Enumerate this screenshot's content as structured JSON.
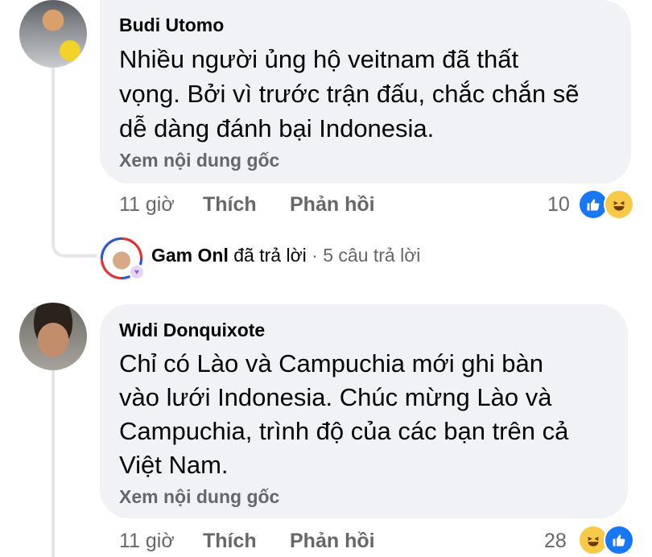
{
  "comments": [
    {
      "author": "Budi Utomo",
      "text_lines": [
        "Nhiều người ủng hộ veitnam đã thất",
        "vọng. Bởi vì trước trận đấu, chắc chắn sẽ",
        "dễ dàng đánh bại Indonesia."
      ],
      "see_original": "Xem nội dung gốc",
      "time": "11 giờ",
      "like_label": "Thích",
      "reply_label": "Phản hồi",
      "reaction_count": "10",
      "reactions": [
        "like-icon",
        "haha-icon"
      ]
    },
    {
      "author": "Widi Donquixote",
      "text_lines": [
        "Chỉ có Lào và Campuchia mới ghi bàn",
        "vào lưới Indonesia. Chúc mừng Lào và",
        "Campuchia, trình độ của các bạn trên cả",
        "Việt Nam."
      ],
      "see_original": "Xem nội dung gốc",
      "time": "11 giờ",
      "like_label": "Thích",
      "reply_label": "Phản hồi",
      "reaction_count": "28",
      "reactions": [
        "haha-icon",
        "like-icon"
      ]
    }
  ],
  "reply_summary": {
    "name": "Gam Onl",
    "action": "đã trả lời",
    "separator": "·",
    "count_text": "5 câu trả lời"
  },
  "colors": {
    "bubble": "#f0f2f5",
    "muted": "#65676b",
    "like": "#1877f2",
    "haha": "#f7c948"
  }
}
